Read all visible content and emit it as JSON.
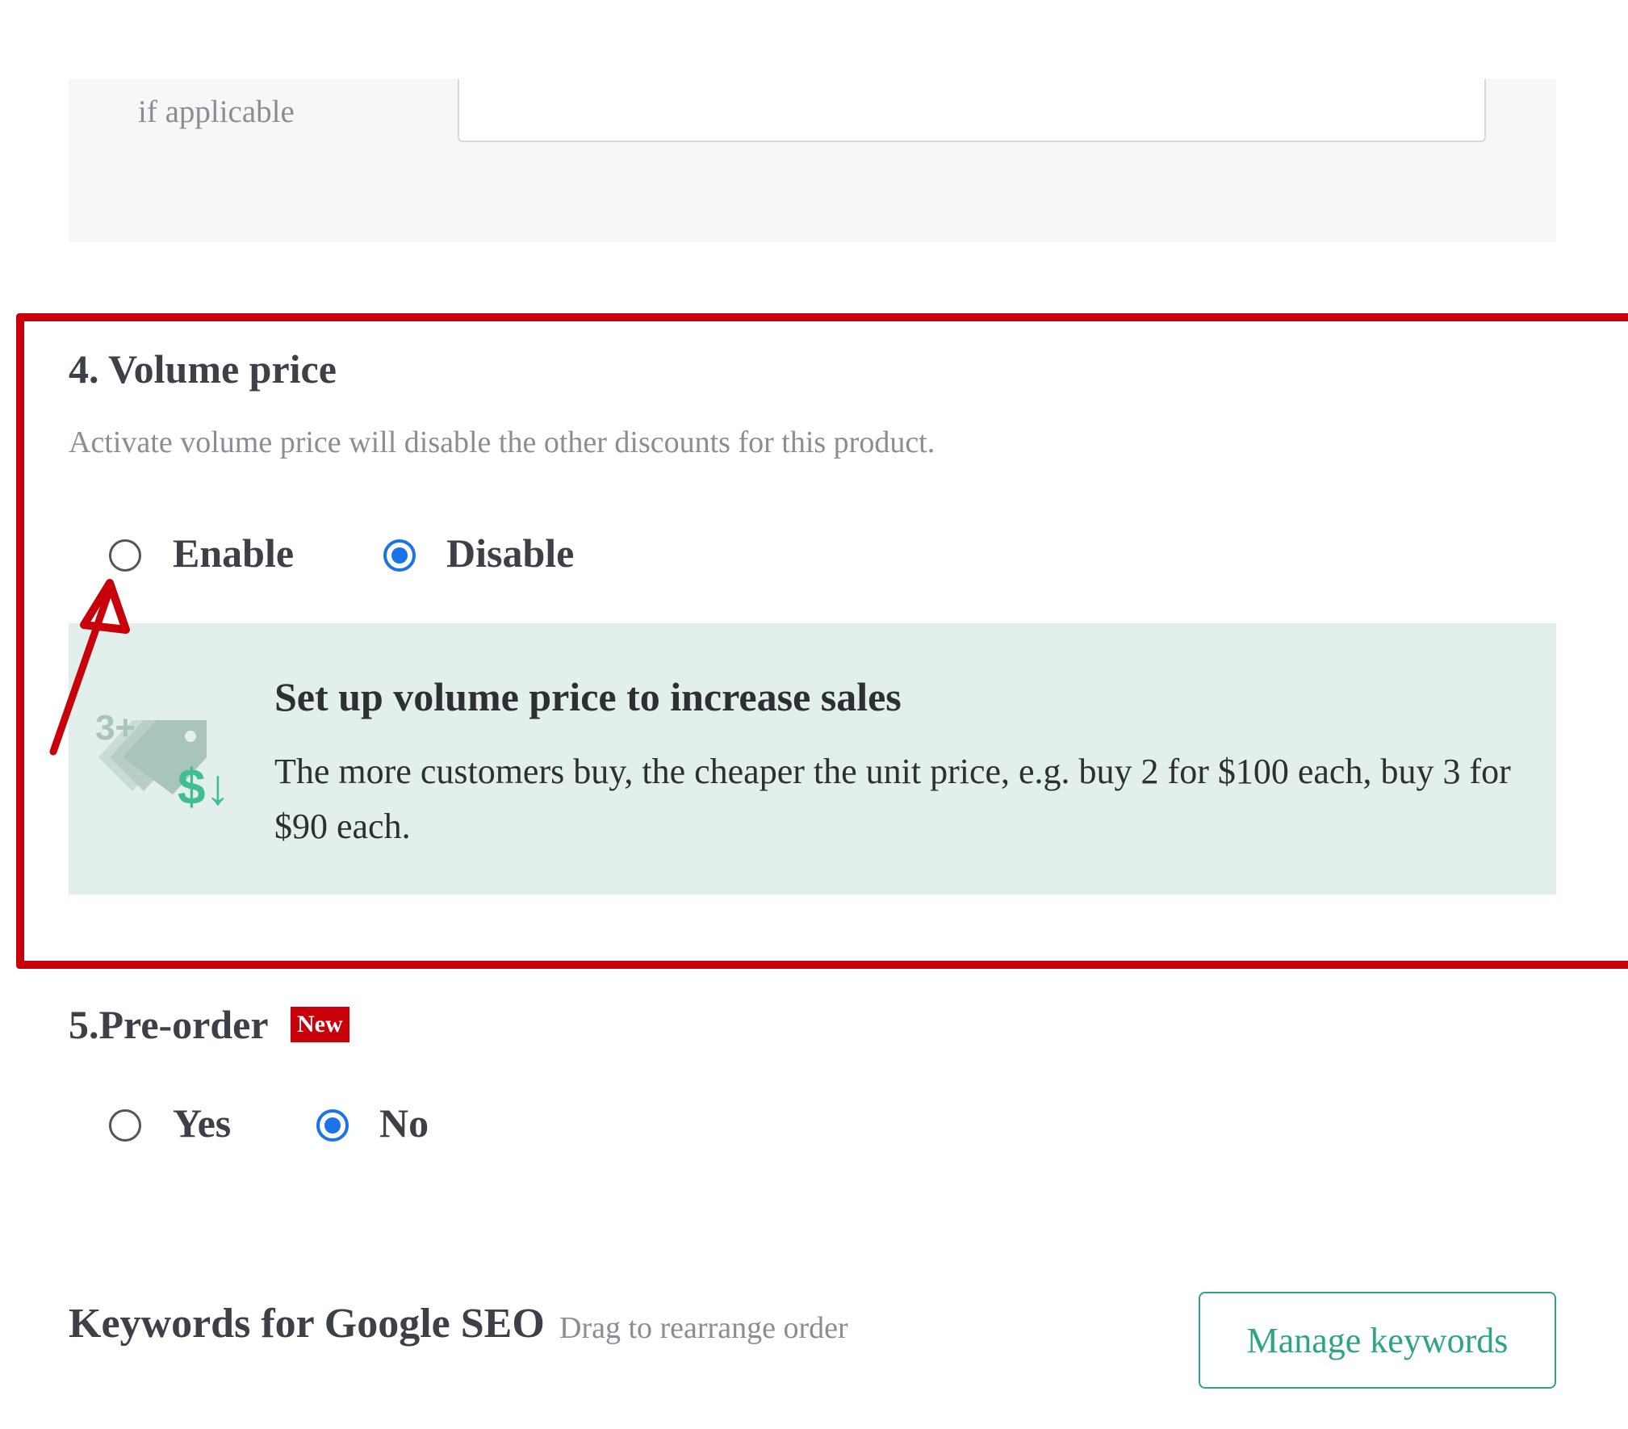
{
  "top_section": {
    "field_label": "if applicable",
    "field_value": ""
  },
  "volume_price": {
    "title": "4. Volume price",
    "description": "Activate volume price will disable the other discounts for this product.",
    "options": [
      {
        "label": "Enable",
        "selected": false
      },
      {
        "label": "Disable",
        "selected": true
      }
    ],
    "promo": {
      "icon": "volume-discount-tag-icon",
      "icon_text": "3+",
      "icon_symbol": "$↓",
      "title": "Set up volume price to increase sales",
      "body": "The more customers buy, the cheaper the unit price, e.g. buy 2 for $100 each, buy 3 for $90 each."
    }
  },
  "pre_order": {
    "title": "5.Pre-order",
    "badge": "New",
    "options": [
      {
        "label": "Yes",
        "selected": false
      },
      {
        "label": "No",
        "selected": true
      }
    ]
  },
  "keywords": {
    "title": "Keywords for Google SEO",
    "hint": "Drag to rearrange order",
    "button_label": "Manage keywords"
  },
  "colors": {
    "accent_blue": "#1a73e8",
    "brand_green": "#2ba585",
    "annotation_red": "#c8000a",
    "info_bg": "#e3efec"
  }
}
